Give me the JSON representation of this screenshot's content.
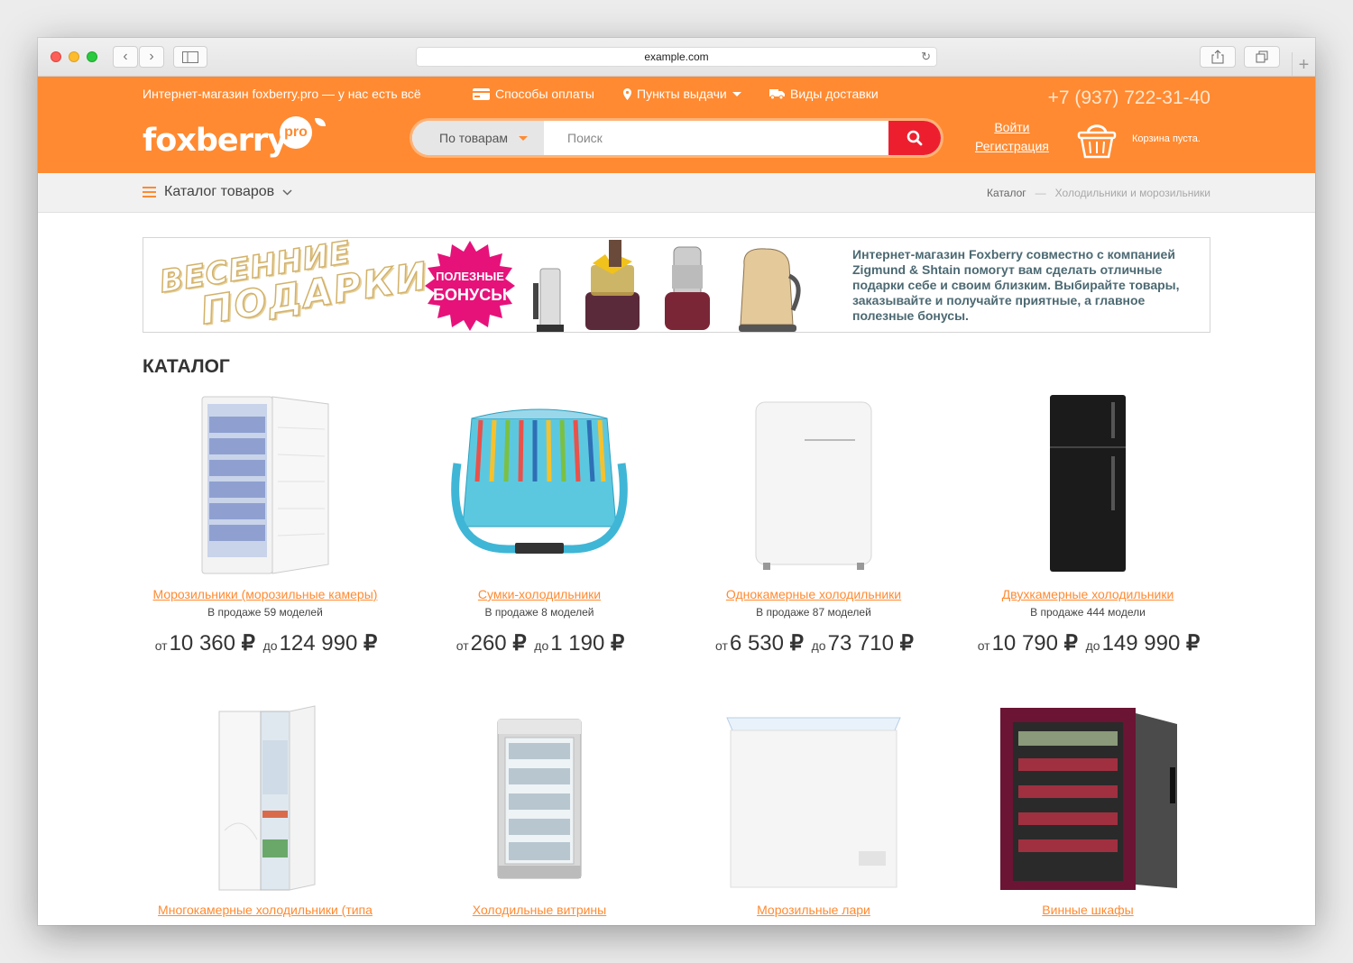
{
  "browser": {
    "url": "example.com",
    "reload_icon": "reload-icon"
  },
  "header": {
    "tagline": "Интернет-магазин foxberry.pro — у нас есть всё",
    "links": [
      {
        "label": "Способы оплаты",
        "icon": "credit-card-icon"
      },
      {
        "label": "Пункты выдачи",
        "icon": "map-pin-icon"
      },
      {
        "label": "Виды доставки",
        "icon": "truck-icon"
      }
    ],
    "phone": "+7 (937) 722-31-40",
    "logo_text": "foxberry",
    "logo_badge": "pro",
    "search": {
      "scope": "По товарам",
      "placeholder": "Поиск"
    },
    "login": "Войти",
    "register": "Регистрация",
    "cart_text": "Корзина пуста."
  },
  "subnav": {
    "catalog_menu": "Каталог товаров",
    "breadcrumbs": [
      "Каталог",
      "Холодильники и морозильники"
    ],
    "breadcrumb_sep": "—"
  },
  "banner": {
    "headline_1": "ВЕСЕННИЕ",
    "headline_2": "ПОДАРКИ",
    "badge_1": "ПОЛЕЗНЫЕ",
    "badge_2": "БОНУСЫ",
    "text": "Интернет-магазин Foxberry совместно с компанией Zigmund & Shtain помогут вам сделать отличные подарки себе и своим близким. Выбирайте товары, заказывайте и получайте приятные, а главное полезные бонусы."
  },
  "catalog": {
    "title": "КАТАЛОГ",
    "from_label": "от",
    "to_label": "до",
    "currency": "₽",
    "items": [
      {
        "name": "Морозильники (морозильные камеры)",
        "stock": "В продаже 59 моделей",
        "price_from": "10 360",
        "price_to": "124 990"
      },
      {
        "name": "Сумки-холодильники",
        "stock": "В продаже 8 моделей",
        "price_from": "260",
        "price_to": "1 190"
      },
      {
        "name": "Однокамерные холодильники",
        "stock": "В продаже 87 моделей",
        "price_from": "6 530",
        "price_to": "73 710"
      },
      {
        "name": "Двухкамерные холодильники",
        "stock": "В продаже 444 модели",
        "price_from": "10 790",
        "price_to": "149 990"
      },
      {
        "name": "Многокамерные холодильники (типа",
        "stock": "",
        "price_from": "",
        "price_to": ""
      },
      {
        "name": "Холодильные витрины",
        "stock": "",
        "price_from": "",
        "price_to": ""
      },
      {
        "name": "Морозильные лари",
        "stock": "",
        "price_from": "",
        "price_to": ""
      },
      {
        "name": "Винные шкафы",
        "stock": "",
        "price_from": "",
        "price_to": ""
      }
    ]
  },
  "colors": {
    "brand_orange": "#ff8a31",
    "search_red": "#ed1f2f",
    "banner_text": "#4c6972"
  }
}
